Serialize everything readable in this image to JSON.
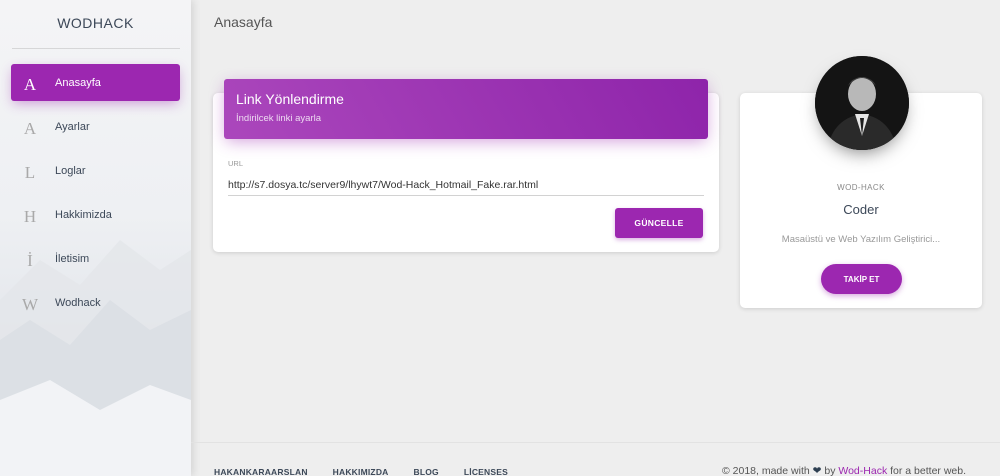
{
  "app": {
    "brand": "WODHACK"
  },
  "sidebar": {
    "items": [
      {
        "letter": "A",
        "label": "Anasayfa",
        "active": true
      },
      {
        "letter": "A",
        "label": "Ayarlar",
        "active": false
      },
      {
        "letter": "L",
        "label": "Loglar",
        "active": false
      },
      {
        "letter": "H",
        "label": "Hakkimizda",
        "active": false
      },
      {
        "letter": "İ",
        "label": "İletisim",
        "active": false
      },
      {
        "letter": "W",
        "label": "Wodhack",
        "active": false
      }
    ]
  },
  "header": {
    "title": "Anasayfa"
  },
  "link_card": {
    "title": "Link Yönlendirme",
    "subtitle": "İndirilcek linki ayarla",
    "url_label": "URL",
    "url_value": "http://s7.dosya.tc/server9/lhywt7/Wod-Hack_Hotmail_Fake.rar.html",
    "update_button": "GÜNCELLE"
  },
  "profile": {
    "role": "WOD-HACK",
    "name": "Coder",
    "description": "Masaüstü ve Web Yazılım Geliştirici...",
    "follow_button": "TAKİP ET"
  },
  "footer": {
    "links": [
      "HAKANKARAARSLAN",
      "HAKKIMIZDA",
      "BLOG",
      "LİCENSES"
    ],
    "copyright_prefix": "© 2018, made with",
    "copyright_by": "by",
    "copyright_brand": "Wod-Hack",
    "copyright_suffix": "for a better web."
  },
  "colors": {
    "accent": "#9c27b0",
    "background": "#eeeeee",
    "text": "#3c4858"
  }
}
